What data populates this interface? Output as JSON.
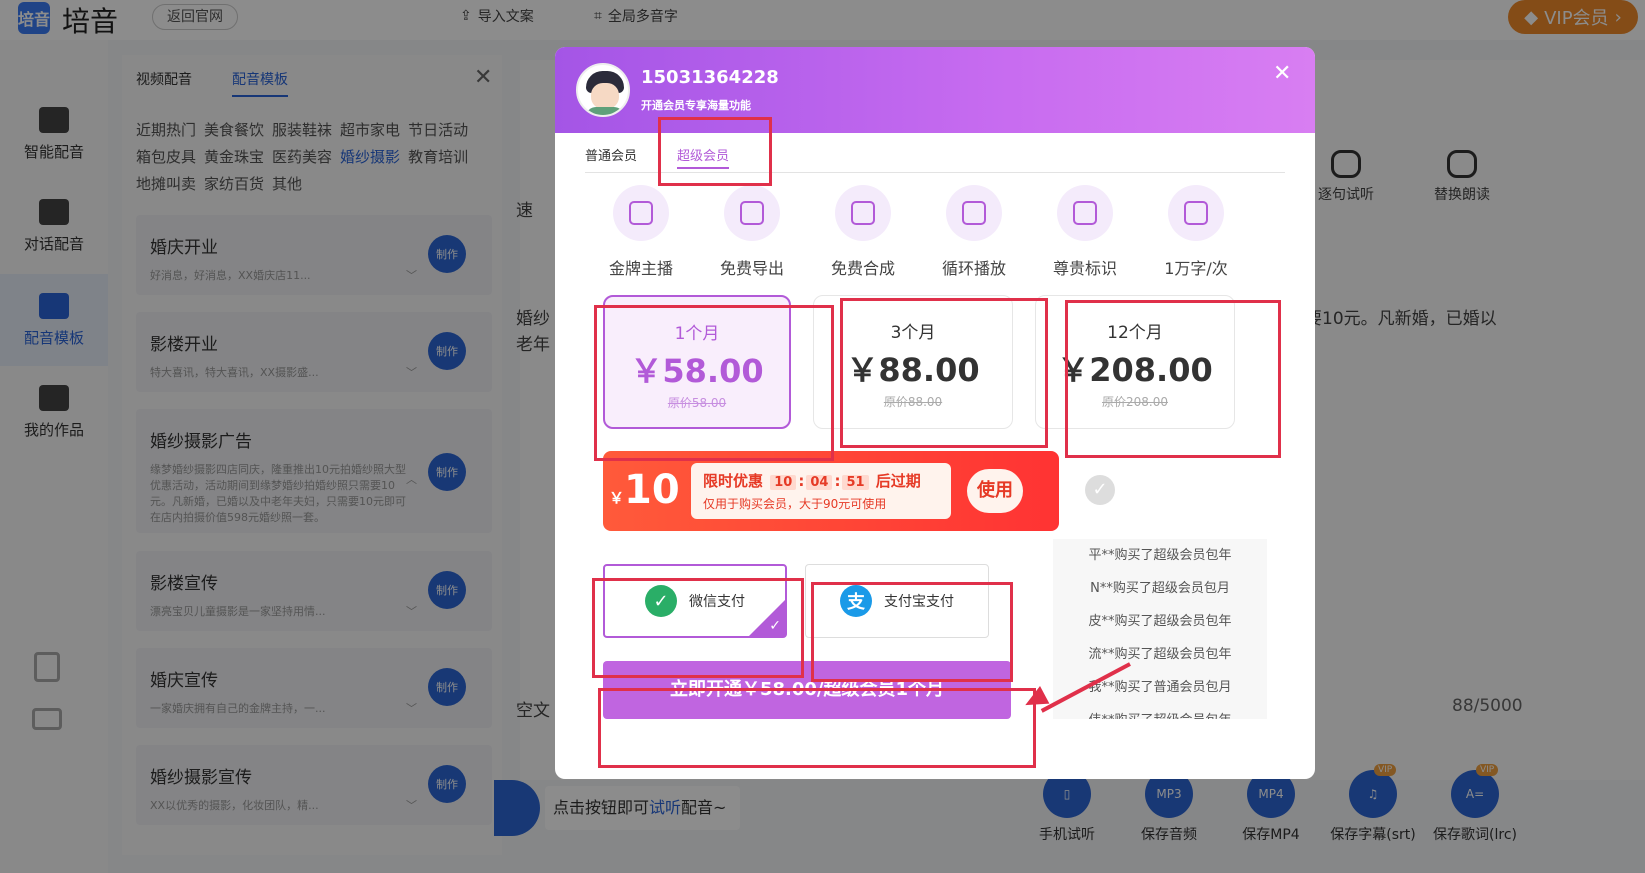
{
  "app": {
    "logo_glyph": "培音",
    "name": "培音",
    "back_label": "返回官网",
    "top_tools": [
      "导入文案",
      "全局多音字"
    ],
    "vip_label": "VIP会员"
  },
  "leftnav": {
    "items": [
      "智能配音",
      "对话配音",
      "配音模板",
      "我的作品"
    ],
    "active": "配音模板"
  },
  "template_panel": {
    "tabs": [
      "视频配音",
      "配音模板"
    ],
    "active_tab": "配音模板",
    "categories": [
      "近期热门",
      "美食餐饮",
      "服装鞋袜",
      "超市家电",
      "节日活动",
      "箱包皮具",
      "黄金珠宝",
      "医药美容",
      "婚纱摄影",
      "教育培训",
      "地摊叫卖",
      "家纺百货",
      "其他"
    ],
    "active_category": "婚纱摄影",
    "make_label": "制作",
    "cards": [
      {
        "title": "婚庆开业",
        "desc": "好消息，好消息，XX婚庆店11..."
      },
      {
        "title": "影楼开业",
        "desc": "特大喜讯，特大喜讯，XX摄影盛..."
      },
      {
        "title": "婚纱摄影广告",
        "desc": "缘梦婚纱摄影四店同庆，隆重推出10元拍婚纱照大型优惠活动，活动期间到缘梦婚纱拍婚纱照只需要10元。凡新婚，已婚以及中老年夫妇，只需要10元即可在店内拍摄价值598元婚纱照一套。"
      },
      {
        "title": "影楼宣传",
        "desc": "漂亮宝贝儿童摄影是一家坚持用情..."
      },
      {
        "title": "婚庆宣传",
        "desc": "一家婚庆拥有自己的金牌主持，一..."
      },
      {
        "title": "婚纱摄影宣传",
        "desc": "XX以优秀的摄影，化妆团队，精..."
      }
    ]
  },
  "background": {
    "fragment_speed": "速",
    "fragment_text1": "婚纱",
    "fragment_text2": "老年",
    "fragment_right": "要10元。凡新婚，已婚以",
    "fragment_clear": "空文",
    "char_count": "88/5000",
    "hint_prefix": "点击按钮即可",
    "hint_link": "试听",
    "hint_suffix": "配音~",
    "tools": [
      "逐句试听",
      "替换朗读"
    ],
    "bottom_tools": [
      {
        "label": "手机试听",
        "icon": "phone-icon",
        "vip": false
      },
      {
        "label": "保存音频",
        "icon": "MP3",
        "vip": false
      },
      {
        "label": "保存MP4",
        "icon": "MP4",
        "vip": true
      },
      {
        "label": "保存字幕(srt)",
        "icon": "music-note-icon",
        "vip": true
      },
      {
        "label": "保存歌词(lrc)",
        "icon": "A=",
        "vip": true
      }
    ],
    "vip_badge": "VIP"
  },
  "modal": {
    "phone": "15031364228",
    "slogan": "开通会员专享海量功能",
    "tabs": [
      "普通会员",
      "超级会员"
    ],
    "active_tab": "超级会员",
    "features": [
      "金牌主播",
      "免费导出",
      "免费合成",
      "循环播放",
      "尊贵标识",
      "1万字/次"
    ],
    "plans": [
      {
        "name": "1个月",
        "price": "￥58.00",
        "orig": "原价58.00",
        "selected": true
      },
      {
        "name": "3个月",
        "price": "￥88.00",
        "orig": "原价88.00",
        "selected": false
      },
      {
        "name": "12个月",
        "price": "￥208.00",
        "orig": "原价208.00",
        "selected": false
      }
    ],
    "coupon": {
      "currency": "￥",
      "amount": "10",
      "title": "限时优惠",
      "timer": [
        "10",
        "04",
        "51"
      ],
      "expire": "后过期",
      "condition": "仅用于购买会员，大于90元可使用",
      "use_label": "使用"
    },
    "payments": [
      {
        "label": "微信支付",
        "selected": true,
        "color": "#2aae67"
      },
      {
        "label": "支付宝支付",
        "selected": false,
        "color": "#1a9ae8"
      }
    ],
    "purchases": [
      "平**购买了超级会员包年",
      "N**购买了超级会员包月",
      "皮**购买了超级会员包年",
      "流**购买了超级会员包年",
      "我**购买了普通会员包月",
      "伟**购买了超级会员包年"
    ],
    "cta": "立即开通￥58.00/超级会员1个月"
  },
  "colors": {
    "accent": "#b25ad8",
    "annotation": "#e0304a",
    "brand_blue": "#2d67d6"
  }
}
